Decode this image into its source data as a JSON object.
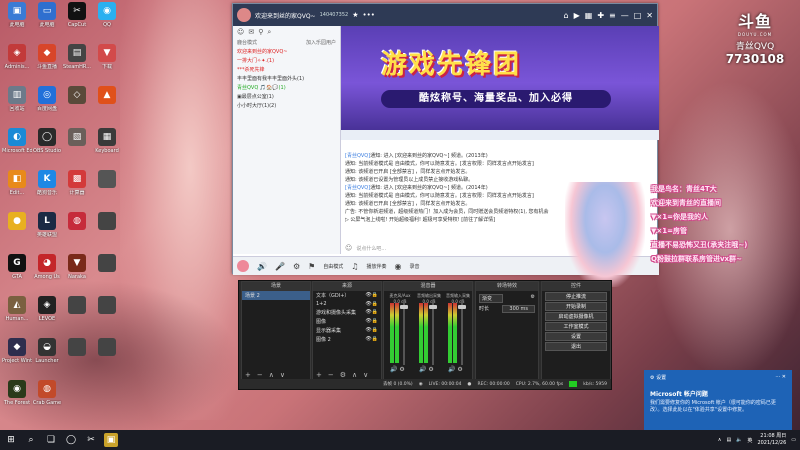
{
  "desktop": {
    "icons": [
      {
        "label": "此电脑",
        "color": "#3a7bd5",
        "glyph": "▣"
      },
      {
        "label": "此电脑",
        "color": "#2f6fcf",
        "glyph": "▭"
      },
      {
        "label": "CapCut",
        "color": "#111111",
        "glyph": "✂"
      },
      {
        "label": "QQ",
        "color": "#2ab0f0",
        "glyph": "◉"
      },
      {
        "label": "Adminis...",
        "color": "#c23a3a",
        "glyph": "◈"
      },
      {
        "label": "斗鱼直播",
        "color": "#d8452a",
        "glyph": "◆"
      },
      {
        "label": "SteamHR...",
        "color": "#444444",
        "glyph": "▤"
      },
      {
        "label": "下载",
        "color": "#d24a4a",
        "glyph": "▼"
      },
      {
        "label": "回收站",
        "color": "#6c7a8a",
        "glyph": "▥"
      },
      {
        "label": "百度网盘",
        "color": "#2270d9",
        "glyph": "◎"
      },
      {
        "label": "",
        "color": "#5a4a3a",
        "glyph": "◇"
      },
      {
        "label": "",
        "color": "#e0501a",
        "glyph": "▲"
      },
      {
        "label": "Microsoft Edge",
        "color": "#1b8ad6",
        "glyph": "◐"
      },
      {
        "label": "OBS Studio",
        "color": "#2a2a2a",
        "glyph": "◯"
      },
      {
        "label": "",
        "color": "#6a5f5a",
        "glyph": "▧"
      },
      {
        "label": "Keyboard",
        "color": "#3a3a3a",
        "glyph": "▦"
      },
      {
        "label": "Edit...",
        "color": "#e88a1a",
        "glyph": "◧"
      },
      {
        "label": "酷狗音乐",
        "color": "#1e88e5",
        "glyph": "K"
      },
      {
        "label": "计算器",
        "color": "#d33a3a",
        "glyph": "▩"
      },
      {
        "label": "",
        "color": "#555555",
        "glyph": ""
      },
      {
        "label": "",
        "color": "#e8b020",
        "glyph": "●"
      },
      {
        "label": "英雄联盟",
        "color": "#1b2a44",
        "glyph": "L"
      },
      {
        "label": "",
        "color": "#c62b3b",
        "glyph": "◍"
      },
      {
        "label": "",
        "color": "#444444",
        "glyph": ""
      },
      {
        "label": "GTA",
        "color": "#111111",
        "glyph": "G"
      },
      {
        "label": "Among Us",
        "color": "#c4262a",
        "glyph": "◕"
      },
      {
        "label": "Naraka",
        "color": "#7a2a1a",
        "glyph": "▼"
      },
      {
        "label": "",
        "color": "#444444",
        "glyph": ""
      },
      {
        "label": "Human...",
        "color": "#7a6040",
        "glyph": "◭"
      },
      {
        "label": "LEVOE",
        "color": "#222222",
        "glyph": "◈"
      },
      {
        "label": "",
        "color": "#444444",
        "glyph": ""
      },
      {
        "label": "",
        "color": "#444444",
        "glyph": ""
      },
      {
        "label": "Project Winter",
        "color": "#2e2e4e",
        "glyph": "◆"
      },
      {
        "label": "Launcher",
        "color": "#333333",
        "glyph": "◒"
      },
      {
        "label": "",
        "color": "#444444",
        "glyph": ""
      },
      {
        "label": "",
        "color": "#444444",
        "glyph": ""
      },
      {
        "label": "The Forest",
        "color": "#2a3a1a",
        "glyph": "◉"
      },
      {
        "label": "Crab Game",
        "color": "#c24a2a",
        "glyph": "◍"
      }
    ]
  },
  "watermark": {
    "logo": "斗鱼",
    "sub": "DOUYU.COM",
    "name": "青丝QVQ",
    "room": "7730108"
  },
  "chat": {
    "title": "欢迎来到丝的家QVQ~",
    "id": "140407352",
    "left_header": "鹿台模式",
    "left_hint": "加入乐园用户",
    "left_items": [
      {
        "text": "欢迎来到丝的家QVQ~",
        "cls": "red"
      },
      {
        "text": "一排大门✧✦.(1)",
        "cls": "red"
      },
      {
        "text": "***杀死先锋",
        "cls": "red"
      },
      {
        "text": "丰丰里面有我丰丰里面外头(1)",
        "cls": ""
      },
      {
        "text": "青丝QVQ 🎵🏠💬(1)",
        "cls": "green"
      },
      {
        "text": "▣最层点公室(1)",
        "cls": ""
      },
      {
        "text": "小小时大厅(1)(2)",
        "cls": ""
      }
    ],
    "banner_big": "游戏先锋团",
    "banner_small": "酷炫称号、海量奖品、加入必得",
    "messages": [
      {
        "tag": "[青丝QVQ]",
        "text": "通知: 进入 [欢迎来到丝的家QVQ~] 频道。(2013年)"
      },
      {
        "tag": "",
        "text": "通知: 当前频道模式是 自由模式，你可以随意发言。[发言权限：同样发言点开始发言]"
      },
      {
        "tag": "",
        "text": "通知: 该频道已开启 [全部禁言] ，同样发言点开始发言。"
      },
      {
        "tag": "",
        "text": "通知: 该频道已设置为管理员以上成员禁止接收游戏私聊。"
      },
      {
        "tag": "[青丝QVQ]",
        "text": "通知: 进入 [欢迎来到丝的家QVQ~] 频道。(2014年)"
      },
      {
        "tag": "",
        "text": "通知: 当前频道模式是 自由模式，你可以随意发言。[发言权限：同样发言点开始发言]"
      },
      {
        "tag": "",
        "text": "通知: 该频道已开启 [全部禁言] ，同样发言点开始发言。"
      },
      {
        "tag": "",
        "text": "广告: 不管你新进频道，超级频道热门！加入成为会员，同时赠送会员频道特权(1), 您有机会"
      },
      {
        "tag": "",
        "text": "  ▷ 公屏气泡上线啦! 开始超级福利! 超极可享受特权! [前往了解详情]"
      }
    ],
    "input_placeholder": "说点什么吧...",
    "bottom": {
      "buttons": [
        "自由模式",
        "播放伴奏",
        "录音"
      ]
    }
  },
  "obs": {
    "scenes_header": "场景",
    "scenes": [
      "场景 2"
    ],
    "sources_header": "来源",
    "sources": [
      "文本（GDI+）",
      "1+2",
      "游戏和摄像头采集",
      "图像",
      "显示器采集",
      "图像 2"
    ],
    "mixer_header": "混音器",
    "mixer": [
      {
        "label": "麦克风/Aux",
        "db": "0.0 dB"
      },
      {
        "label": "音频输出采集",
        "db": "0.0 dB"
      },
      {
        "label": "音频输入采集",
        "db": "0.0 dB"
      }
    ],
    "transitions_header": "转场特效",
    "transition": "渐变",
    "duration_label": "时长",
    "duration": "300 ms",
    "controls_header": "控件",
    "controls": [
      "停止推流",
      "开始录制",
      "启动虚拟摄像机",
      "工作室模式",
      "设置",
      "退出"
    ],
    "status": {
      "dropped": "丢帧 0 (0.0%)",
      "live": "LIVE: 00:00:04",
      "rec": "REC: 00:00:00",
      "cpu": "CPU: 2.7%, 60.00 fps",
      "bitrate": "kb/s: 5959"
    }
  },
  "anime": {
    "lines": [
      "我是鸟名：青丝4T大",
      "欢迎来到青丝的直播间",
      "▼×1=你是我的人",
      "▼×1=房管",
      "直播不易恐怖又丑(承夹注哦~)",
      "Q粉鼓拉群联系房管进vx群~"
    ]
  },
  "notification": {
    "app": "设置",
    "title": "Microsoft 帐户问题",
    "body": "我们需要修复你的 Microsoft 帐户（很可能你的密码已更改）。选择此处以在\"体验共享\"设置中修复。"
  },
  "taskbar": {
    "time": "21:08 周日",
    "date": "2021/12/26",
    "lang": "英"
  }
}
